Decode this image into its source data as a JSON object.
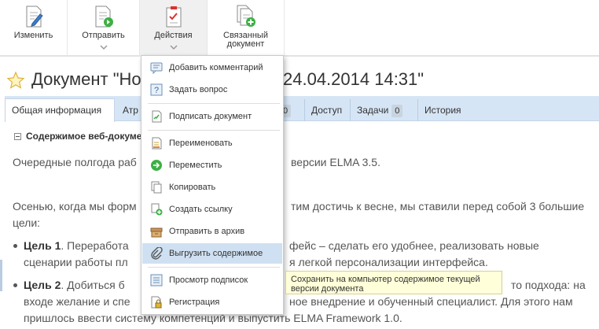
{
  "toolbar": {
    "buttons": [
      {
        "label": "Изменить",
        "icon": "edit-document-icon"
      },
      {
        "label": "Отправить",
        "icon": "send-document-icon"
      },
      {
        "label": "Действия",
        "icon": "actions-clipboard-icon"
      },
      {
        "label_line1": "Связанный",
        "label_line2": "документ",
        "icon": "linked-document-icon"
      }
    ]
  },
  "document": {
    "title_left": "Документ \"Нов",
    "title_right": "24.04.2014 14:31\""
  },
  "tabs": {
    "general": "Общая информация",
    "attributes": "Атр",
    "hidden_count": "0",
    "access": "Доступ",
    "tasks": "Задачи",
    "tasks_count": "0",
    "history": "История"
  },
  "content": {
    "section_title": "Содержимое веб-докуме",
    "p1_left": "Очередные полгода раб",
    "p1_right": "версии ELMA 3.5.",
    "p2_left": "Осенью, когда мы форм",
    "p2_right": "тим достичь к весне, мы ставили перед собой 3 большие",
    "p2_line2": "цели:",
    "goal1_label": "Цель 1",
    "goal1_left": ". Переработа",
    "goal1_right": "фейс – сделать его удобнее, реализовать новые",
    "goal1_line2_left": "сценарии работы пл",
    "goal1_line2_right": "я легкой персонализации интерфейса.",
    "goal2_label": "Цель 2",
    "goal2_left": ". Добиться б",
    "goal2_right": "то подхода: на",
    "goal2_line2_left": "входе желание и спе",
    "goal2_line2_right": "ное внедрение и обученный специалист. Для этого нам",
    "goal2_line3": "пришлось ввести систему компетенций и выпустить ELMA Framework 1.0."
  },
  "menu": {
    "items": [
      {
        "label": "Добавить комментарий",
        "icon": "comment-icon"
      },
      {
        "label": "Задать вопрос",
        "icon": "question-icon"
      },
      {
        "label": "Подписать документ",
        "icon": "sign-document-icon"
      },
      {
        "label": "Переименовать",
        "icon": "rename-icon"
      },
      {
        "label": "Переместить",
        "icon": "move-arrow-icon"
      },
      {
        "label": "Копировать",
        "icon": "copy-icon"
      },
      {
        "label": "Создать ссылку",
        "icon": "create-link-icon"
      },
      {
        "label": "Отправить в архив",
        "icon": "archive-box-icon"
      },
      {
        "label": "Выгрузить содержимое",
        "icon": "paperclip-icon"
      },
      {
        "label": "Просмотр подписок",
        "icon": "subscriptions-icon"
      },
      {
        "label": "Регистрация",
        "icon": "registration-lock-icon"
      }
    ]
  },
  "tooltip": {
    "line1": "Сохранить на компьютер содержимое текущей",
    "line2": "версии документа"
  },
  "colors": {
    "tab_bar": "#d6e5f5",
    "menu_highlight": "#cfe0f2",
    "tooltip_bg": "#ffffd9",
    "accent_green": "#3cb043",
    "accent_red": "#d9342b"
  }
}
